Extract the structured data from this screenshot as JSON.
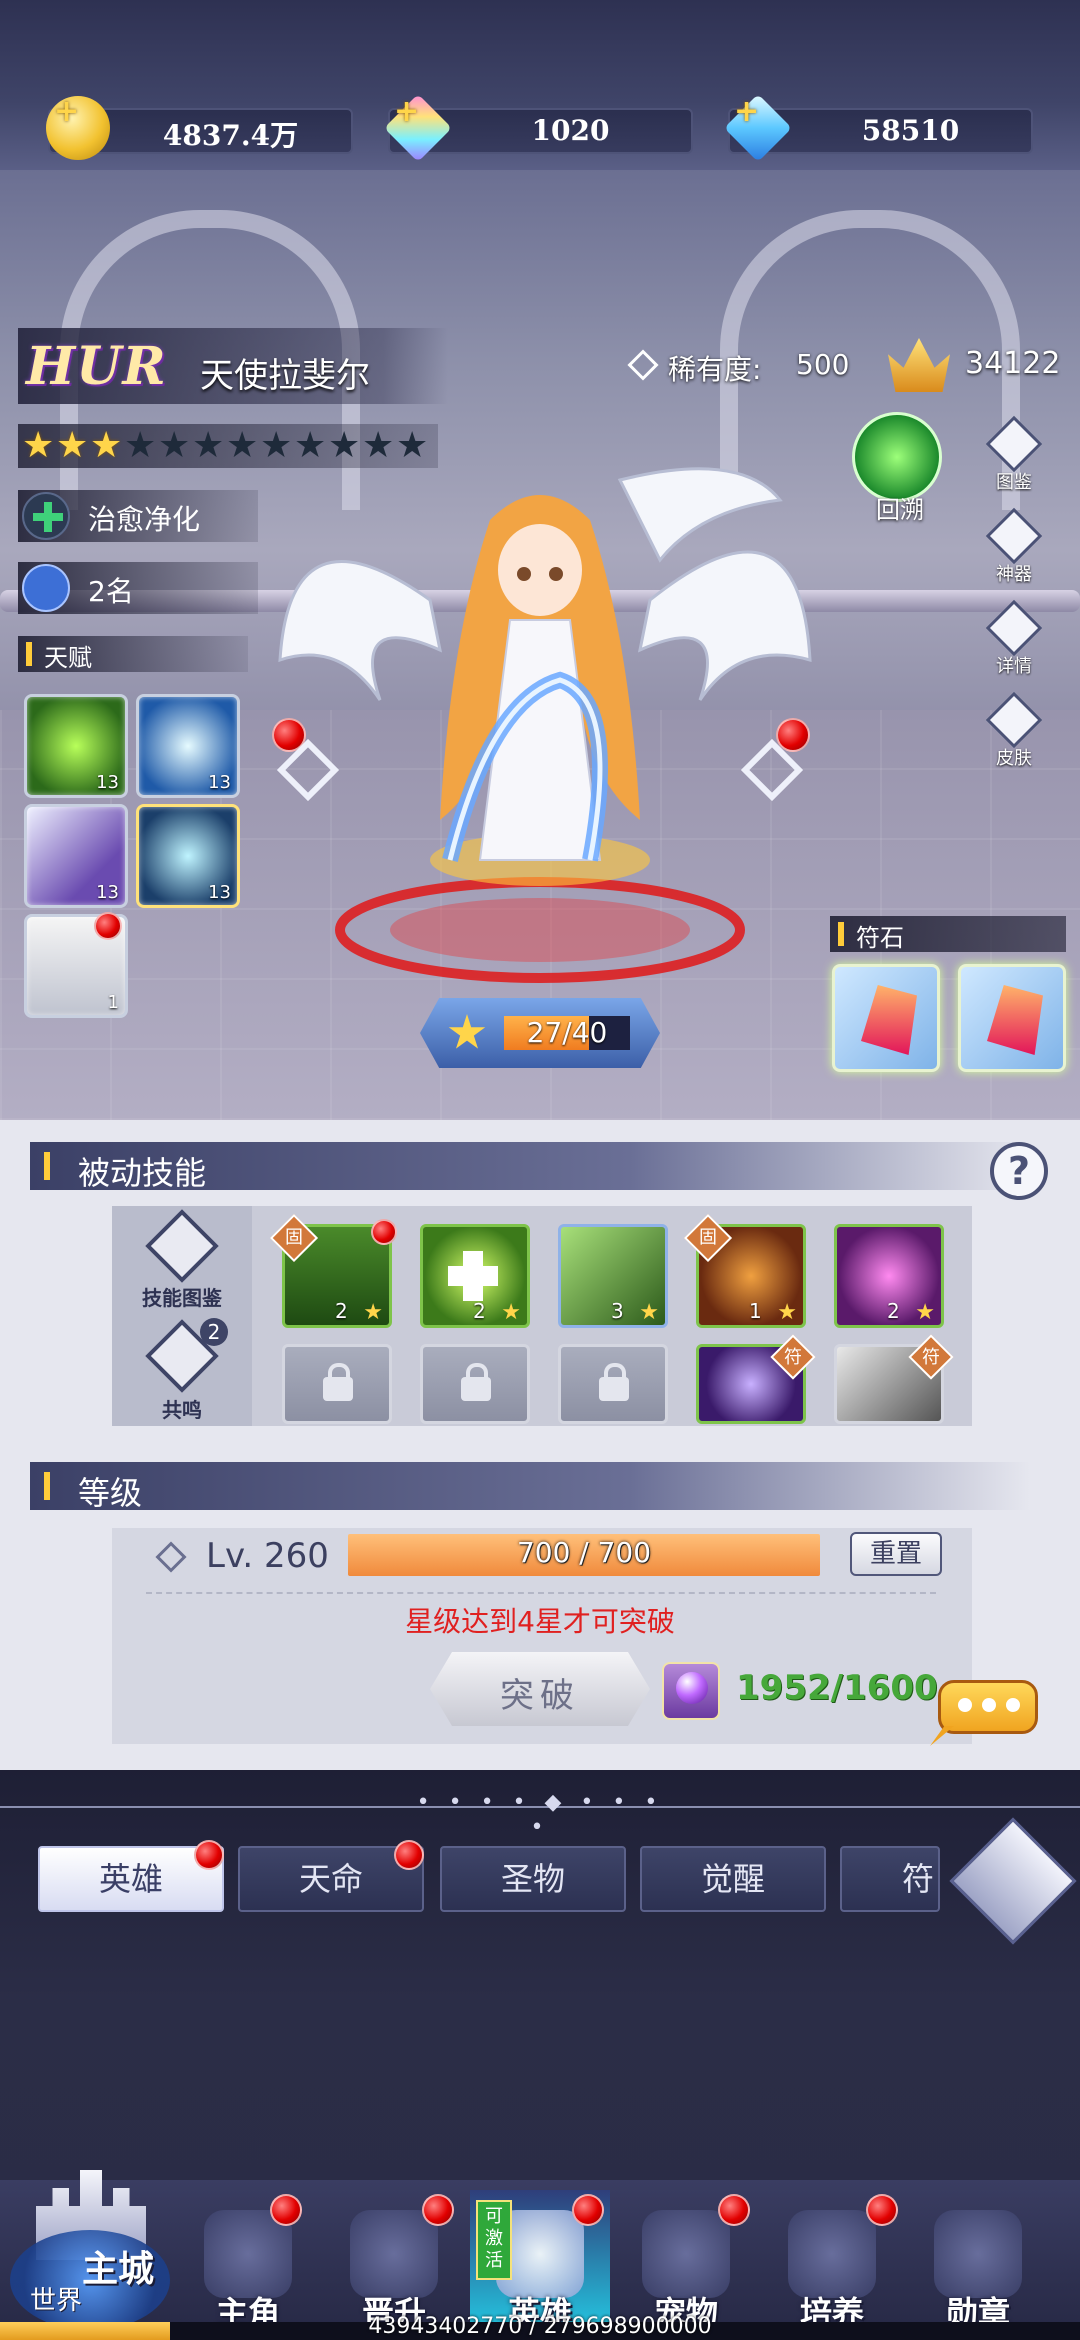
{
  "resources": [
    {
      "name": "gold",
      "icon": "gold-coin-icon",
      "value": "4837.4万"
    },
    {
      "name": "rainbow-gem",
      "icon": "rainbow-diamond-icon",
      "value": "1020"
    },
    {
      "name": "blue-gem",
      "icon": "blue-diamond-icon",
      "value": "58510"
    }
  ],
  "hero": {
    "grade": "HUR",
    "name": "天使拉斐尔",
    "rarity_label": "稀有度:",
    "rarity_value": "500",
    "power": "34122",
    "stars_total": 12,
    "stars_lit": 3,
    "class": "治愈净化",
    "rank": "2名"
  },
  "scene": {
    "talent_label": "天赋",
    "talents": [
      {
        "level": "13",
        "icon": "green-flame-skill-icon"
      },
      {
        "level": "13",
        "icon": "ice-shard-skill-icon"
      },
      {
        "level": "13",
        "icon": "wing-slash-skill-icon"
      },
      {
        "level": "13",
        "icon": "orb-skill-icon"
      },
      {
        "level": "1",
        "icon": "white-wing-skill-icon"
      }
    ],
    "side_buttons": [
      {
        "label": "回溯",
        "icon": "rewind-icon"
      },
      {
        "label": "图鉴",
        "icon": "codex-icon"
      },
      {
        "label": "神器",
        "icon": "artifact-icon"
      },
      {
        "label": "详情",
        "icon": "details-icon"
      },
      {
        "label": "皮肤",
        "icon": "skin-icon"
      }
    ],
    "exp_current": "27/40",
    "exp_fraction": 0.675,
    "rune_label": "符石"
  },
  "passive": {
    "title": "被动技能",
    "help": "?",
    "left_buttons": [
      {
        "label": "技能图鉴",
        "icon": "skill-codex-icon"
      },
      {
        "label": "共鸣",
        "icon": "resonance-icon",
        "badge": "2"
      }
    ],
    "skills": [
      {
        "level": "2",
        "badge": "固",
        "icon": "bamboo-skill-icon"
      },
      {
        "level": "2",
        "icon": "heal-cross-skill-icon"
      },
      {
        "level": "3",
        "icon": "dancer-skill-icon"
      },
      {
        "level": "1",
        "badge": "固",
        "icon": "knight-skill-icon"
      },
      {
        "level": "2",
        "icon": "purple-claw-skill-icon"
      }
    ],
    "second_row_badges": [
      "符",
      "符"
    ]
  },
  "level": {
    "title": "等级",
    "lv_text": "Lv. 260",
    "progress": "700 / 700",
    "progress_fraction": 1.0,
    "reset": "重置",
    "warning": "星级达到4星才可突破",
    "break_button": "突破",
    "material_count": "1952/1600"
  },
  "tabs": [
    "英雄",
    "天命",
    "圣物",
    "觉醒",
    "符文"
  ],
  "nav": {
    "home_label": "主城",
    "world_label": "世界",
    "items": [
      {
        "label": "主角",
        "icon": "hero-portrait-icon"
      },
      {
        "label": "晋升",
        "icon": "promote-icon"
      },
      {
        "label": "英雄",
        "icon": "helmet-icon",
        "tag": "可激活"
      },
      {
        "label": "宠物",
        "icon": "pet-icon"
      },
      {
        "label": "培养",
        "icon": "train-icon"
      },
      {
        "label": "勋章",
        "icon": "medal-icon"
      }
    ],
    "xp_text": "43943402770 / 279698900000",
    "xp_fraction": 0.157
  }
}
